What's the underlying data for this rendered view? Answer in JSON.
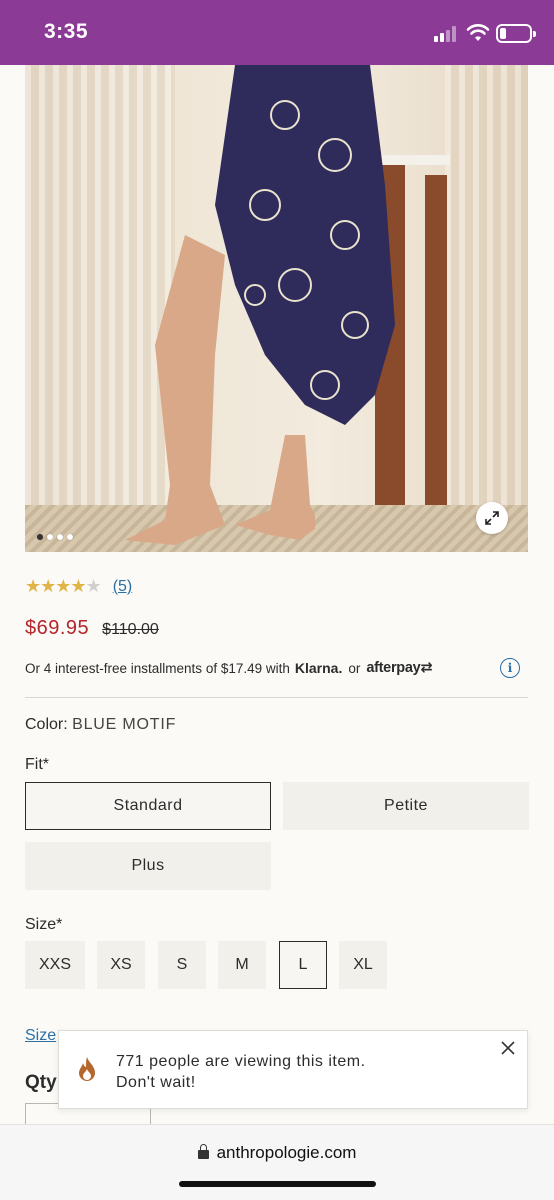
{
  "status_bar": {
    "time": "3:35"
  },
  "product": {
    "rating_stars": 4.5,
    "review_count": "(5)",
    "sale_price": "$69.95",
    "original_price": "$110.00",
    "image_dots": 4,
    "active_image": 1
  },
  "payment": {
    "installments_text": "Or 4 interest-free installments of $17.49 with",
    "klarna_label": "Klarna.",
    "or_text": "or",
    "afterpay_label": "afterpay"
  },
  "color": {
    "label": "Color:",
    "value": "BLUE MOTIF"
  },
  "fit": {
    "label": "Fit*",
    "options": [
      "Standard",
      "Petite",
      "Plus"
    ],
    "selected": "Standard"
  },
  "size": {
    "label": "Size*",
    "options": [
      "XXS",
      "XS",
      "S",
      "M",
      "L",
      "XL"
    ],
    "selected": "L"
  },
  "size_guide_label": "Size",
  "qty_label": "Qty",
  "toast": {
    "line1": "771 people are viewing this item.",
    "line2": "Don't wait!"
  },
  "browser": {
    "url": "anthropologie.com"
  },
  "colors": {
    "status_bar": "#8b3a96",
    "sale_price": "#b3262c",
    "link": "#2a6fa6",
    "star": "#e0b547"
  }
}
